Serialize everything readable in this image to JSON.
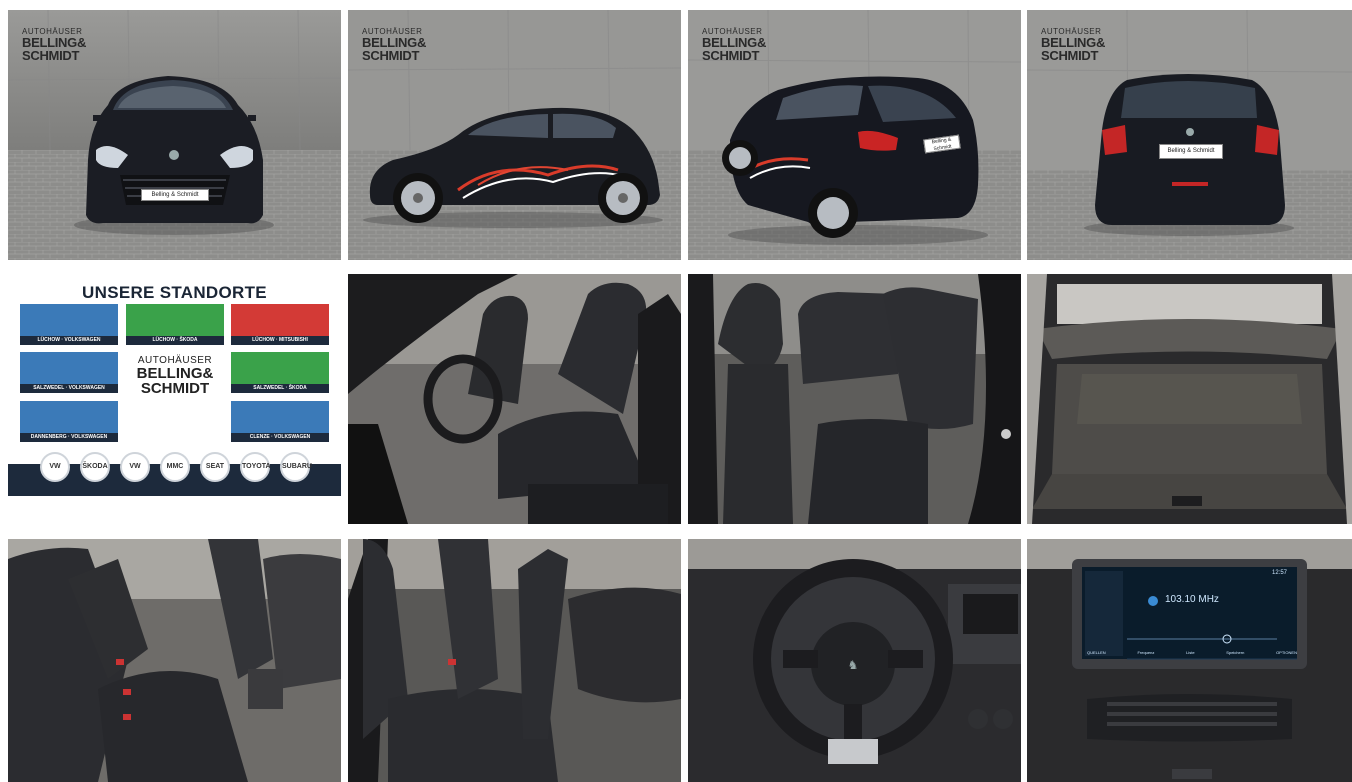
{
  "brand": {
    "line1": "AUTOHÄUSER",
    "line2": "BELLING&",
    "line3": "SCHMIDT"
  },
  "plate_text": "Belling & Schmidt",
  "locations": {
    "title": "UNSERE STANDORTE",
    "sites": [
      {
        "label": "LÜCHOW · VOLKSWAGEN",
        "color": "#3b7ab8"
      },
      {
        "label": "LÜCHOW · ŠKODA",
        "color": "#3aa24a"
      },
      {
        "label": "LÜCHOW · MITSUBISHI",
        "color": "#d33a36"
      },
      {
        "label": "SALZWEDEL · VOLKSWAGEN",
        "color": "#3b7ab8"
      },
      {
        "label": "SALZWEDEL · ŠKODA",
        "color": "#3aa24a"
      },
      {
        "label": "DANNENBERG · VOLKSWAGEN",
        "color": "#3b7ab8"
      },
      {
        "label": "CLENZE · VOLKSWAGEN",
        "color": "#3b7ab8"
      }
    ],
    "logo": {
      "l1": "AUTOHÄUSER",
      "l2": "BELLING&",
      "l3": "SCHMIDT"
    },
    "brands": [
      "VW",
      "ŠKODA",
      "VW",
      "MMC",
      "SEAT",
      "TOYOTA",
      "SUBARU"
    ]
  },
  "radio": {
    "frequency": "103.10 MHz",
    "time": "12:57",
    "tabs": [
      "QUELLEN",
      "Frequenz",
      "Liste",
      "Speichern",
      "OPTIONEN"
    ]
  },
  "photos": [
    {
      "name": "photo-front"
    },
    {
      "name": "photo-side"
    },
    {
      "name": "photo-rear-three-quarter"
    },
    {
      "name": "photo-rear"
    },
    {
      "name": "photo-locations"
    },
    {
      "name": "photo-front-seats"
    },
    {
      "name": "photo-rear-seat-door"
    },
    {
      "name": "photo-trunk"
    },
    {
      "name": "photo-rear-bench"
    },
    {
      "name": "photo-passenger-seat"
    },
    {
      "name": "photo-steering-wheel"
    },
    {
      "name": "photo-infotainment"
    }
  ]
}
